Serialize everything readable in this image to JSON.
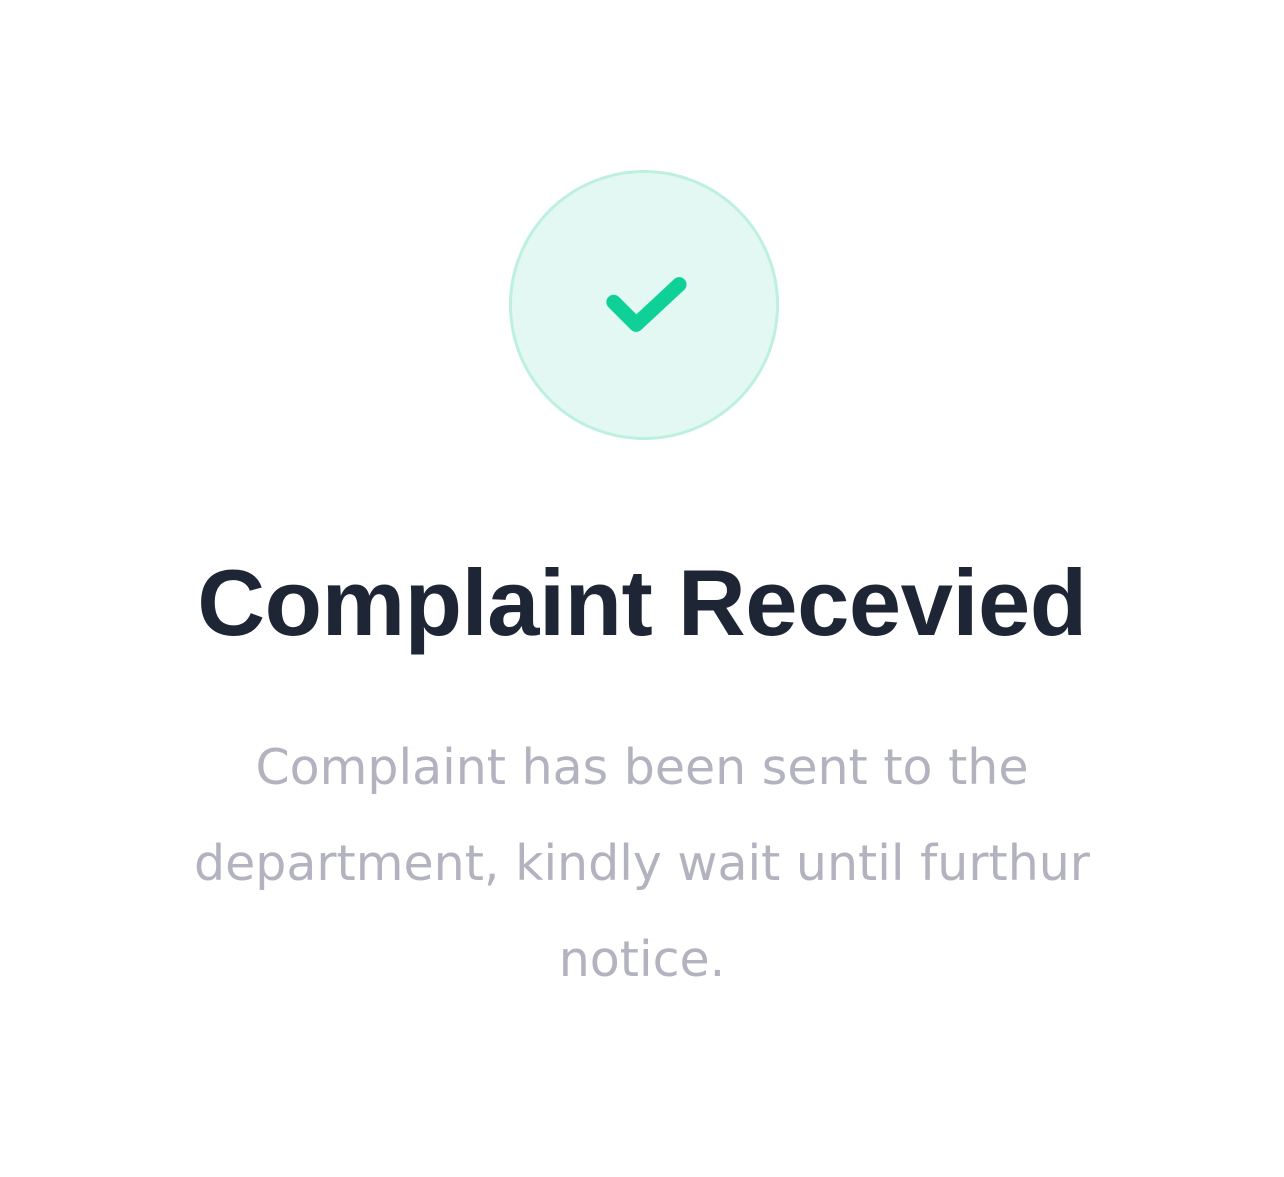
{
  "status": {
    "icon": "check-icon",
    "accent_color": "#0fd197",
    "circle_fill": "#e3f8f2",
    "circle_border": "#bdf0e0"
  },
  "title": "Complaint Recevied",
  "message": "Complaint has been sent to the department, kindly wait until furthur notice."
}
